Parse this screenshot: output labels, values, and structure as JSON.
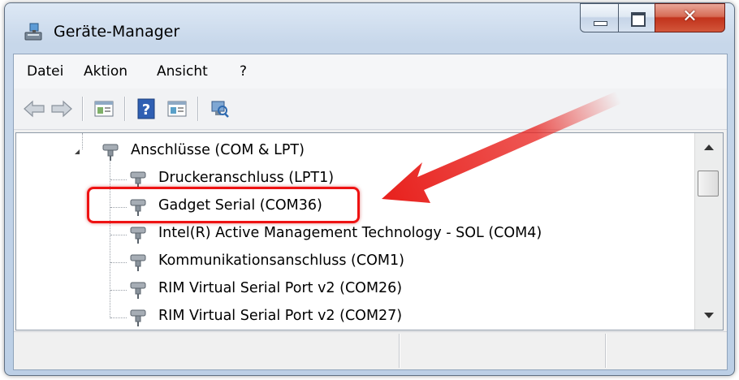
{
  "window": {
    "title": "Geräte-Manager",
    "controls": [
      "minimize",
      "maximize",
      "close"
    ]
  },
  "menu": {
    "items": [
      {
        "label": "Datei"
      },
      {
        "label": "Aktion"
      },
      {
        "label": "Ansicht"
      },
      {
        "label": "?"
      }
    ]
  },
  "toolbar": {
    "icons": [
      "back-arrow-icon",
      "forward-arrow-icon",
      "properties-icon",
      "help-icon",
      "view-icon",
      "scan-hardware-icon"
    ]
  },
  "tree": {
    "category": {
      "label": "Anschlüsse (COM & LPT)",
      "expanded": true
    },
    "devices": [
      {
        "label": "Druckeranschluss (LPT1)"
      },
      {
        "label": "Gadget Serial (COM36)",
        "highlighted": true
      },
      {
        "label": "Intel(R) Active Management Technology - SOL (COM4)"
      },
      {
        "label": "Kommunikationsanschluss (COM1)"
      },
      {
        "label": "RIM Virtual Serial Port v2 (COM26)"
      },
      {
        "label": "RIM Virtual Serial Port v2 (COM27)"
      }
    ]
  },
  "colors": {
    "highlight": "#ee1212",
    "arrow": "#e8201c"
  }
}
